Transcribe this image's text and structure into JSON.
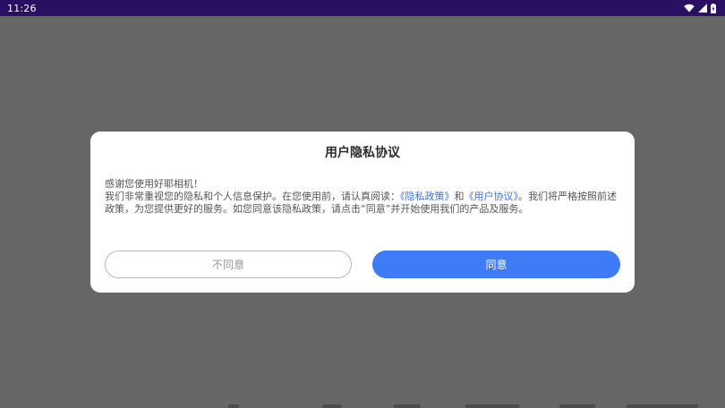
{
  "status_bar": {
    "time": "11:26",
    "icons": [
      "wifi-icon",
      "cellular-signal-icon",
      "battery-icon"
    ]
  },
  "dialog": {
    "title": "用户隐私协议",
    "greeting": "感谢您使用好耶相机！",
    "body_start": "我们非常重视您的隐私和个人信息保护。在您使用前，请认真阅读：",
    "privacy_link": "《隐私政策》",
    "conjunction": "和",
    "user_agreement_link": "《用户协议》",
    "body_end": "。我们将严格按照前述政策，为您提供更好的服务。如您同意该隐私政策，请点击“同意”并开始使用我们的产品及服务。",
    "decline_label": "不同意",
    "agree_label": "同意"
  },
  "colors": {
    "status_bar": "#2a0f63",
    "overlay": "#666666",
    "accent": "#3d7bf7",
    "link": "#3b72d9"
  }
}
